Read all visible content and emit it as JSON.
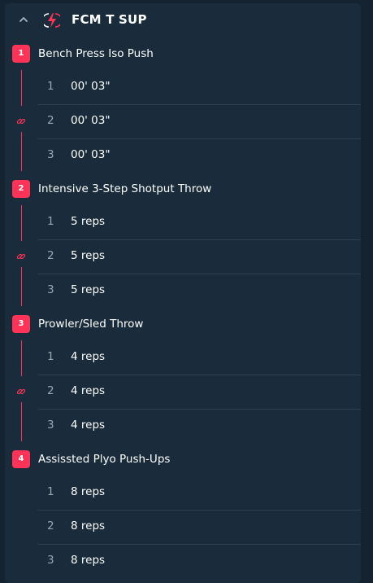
{
  "header": {
    "title": "FCM T SUP"
  },
  "icons": {
    "collapse": "chevron-up-icon",
    "logo": "lightning-bolt-logo",
    "superset": "link-icon"
  },
  "colors": {
    "accent": "#ff3358",
    "background": "#1a2c3b"
  },
  "exercises": [
    {
      "number": "1",
      "name": "Bench Press Iso Push",
      "sets": [
        {
          "num": "1",
          "value": "00' 03\""
        },
        {
          "num": "2",
          "value": "00' 03\""
        },
        {
          "num": "3",
          "value": "00' 03\""
        }
      ]
    },
    {
      "number": "2",
      "name": "Intensive 3-Step Shotput Throw",
      "sets": [
        {
          "num": "1",
          "value": "5 reps"
        },
        {
          "num": "2",
          "value": "5 reps"
        },
        {
          "num": "3",
          "value": "5 reps"
        }
      ]
    },
    {
      "number": "3",
      "name": "Prowler/Sled Throw",
      "sets": [
        {
          "num": "1",
          "value": "4 reps"
        },
        {
          "num": "2",
          "value": "4 reps"
        },
        {
          "num": "3",
          "value": "4 reps"
        }
      ]
    },
    {
      "number": "4",
      "name": "Assissted Plyo Push-Ups",
      "sets": [
        {
          "num": "1",
          "value": "8 reps"
        },
        {
          "num": "2",
          "value": "8 reps"
        },
        {
          "num": "3",
          "value": "8 reps"
        }
      ]
    }
  ]
}
